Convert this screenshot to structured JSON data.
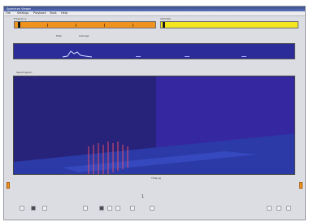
{
  "window": {
    "title": "Spectrum Viewer",
    "menu": [
      "File",
      "Settings",
      "Playback",
      "Tools",
      "Help"
    ]
  },
  "panels": {
    "left_bar_label": "Frequency",
    "right_bar_label": "Intensity",
    "legend_a": "Peak",
    "legend_b": "Average",
    "overview_label": "Overview",
    "main_label": "Spectrogram",
    "main_axis_label": "Time (s)",
    "page_indicator": "1"
  },
  "colors": {
    "orange_bar": "#f0931e",
    "yellow_bar": "#f3e51e",
    "overview_bg": "#2b2c9a",
    "main_bg": "#27227a",
    "spike": "#e0506a"
  },
  "toolbar": {
    "icons": [
      "rewind-icon",
      "record-icon",
      "play-icon",
      "pencil-icon",
      "stop-icon",
      "zoom-in-icon",
      "zoom-out-icon",
      "grid-icon",
      "settings-icon",
      "export-icon",
      "fit-icon",
      "help-icon"
    ]
  }
}
